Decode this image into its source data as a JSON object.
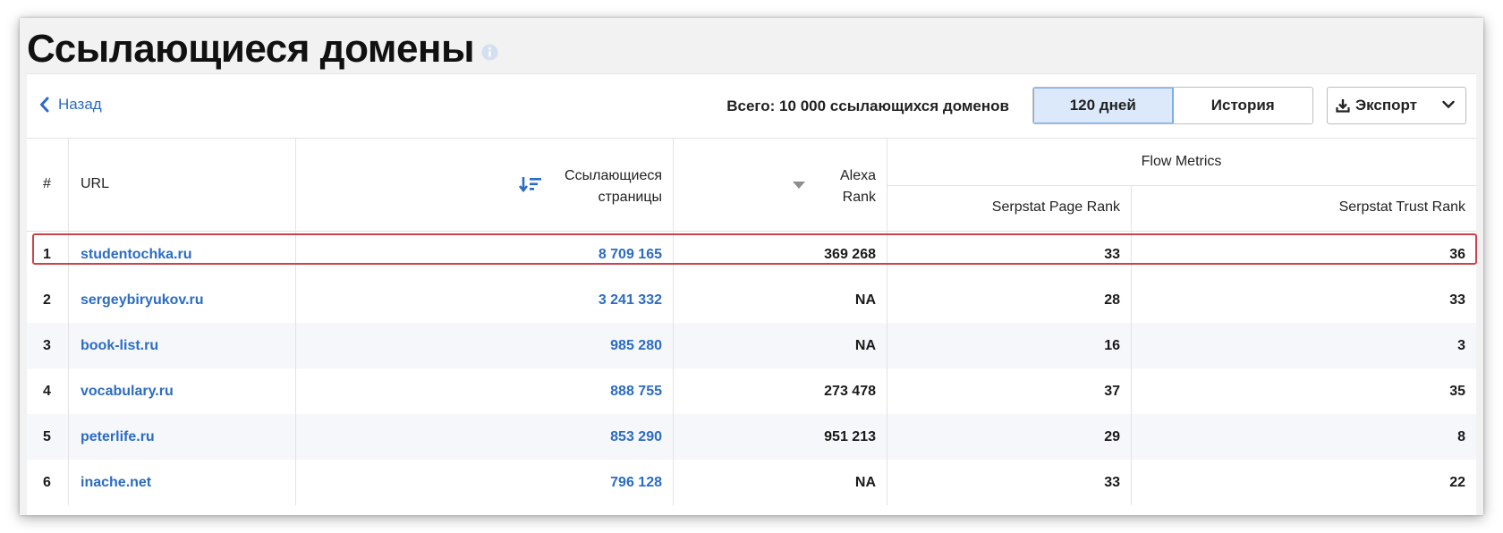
{
  "page": {
    "title": "Ссылающиеся домены"
  },
  "toolbar": {
    "back_label": "Назад",
    "total_text": "Всего: 10 000 ссылающихся доменов",
    "period_active": "120 дней",
    "period_history": "История",
    "export_label": "Экспорт"
  },
  "table": {
    "headers": {
      "num": "#",
      "url": "URL",
      "ref_pages_line1": "Ссылающиеся",
      "ref_pages_line2": "страницы",
      "alexa_line1": "Alexa",
      "alexa_line2": "Rank",
      "flow_metrics": "Flow Metrics",
      "page_rank": "Serpstat Page Rank",
      "trust_rank": "Serpstat Trust Rank"
    },
    "rows": [
      {
        "num": "1",
        "url": "studentochka.ru",
        "ref_pages": "8 709 165",
        "alexa": "369 268",
        "page_rank": "33",
        "trust_rank": "36"
      },
      {
        "num": "2",
        "url": "sergeybiryukov.ru",
        "ref_pages": "3 241 332",
        "alexa": "NA",
        "page_rank": "28",
        "trust_rank": "33"
      },
      {
        "num": "3",
        "url": "book-list.ru",
        "ref_pages": "985 280",
        "alexa": "NA",
        "page_rank": "16",
        "trust_rank": "3"
      },
      {
        "num": "4",
        "url": "vocabulary.ru",
        "ref_pages": "888 755",
        "alexa": "273 478",
        "page_rank": "37",
        "trust_rank": "35"
      },
      {
        "num": "5",
        "url": "peterlife.ru",
        "ref_pages": "853 290",
        "alexa": "951 213",
        "page_rank": "29",
        "trust_rank": "8"
      },
      {
        "num": "6",
        "url": "inache.net",
        "ref_pages": "796 128",
        "alexa": "NA",
        "page_rank": "33",
        "trust_rank": "22"
      }
    ]
  },
  "colors": {
    "link": "#2b6cc4",
    "highlight": "#c9454b",
    "active_toggle": "#dbe9fb"
  },
  "icons": {
    "info": "info-icon",
    "back": "chevron-left-icon",
    "sort": "sort-descending-icon",
    "alexa_sort": "caret-down-icon",
    "export": "download-icon",
    "export_dropdown": "chevron-down-icon"
  }
}
